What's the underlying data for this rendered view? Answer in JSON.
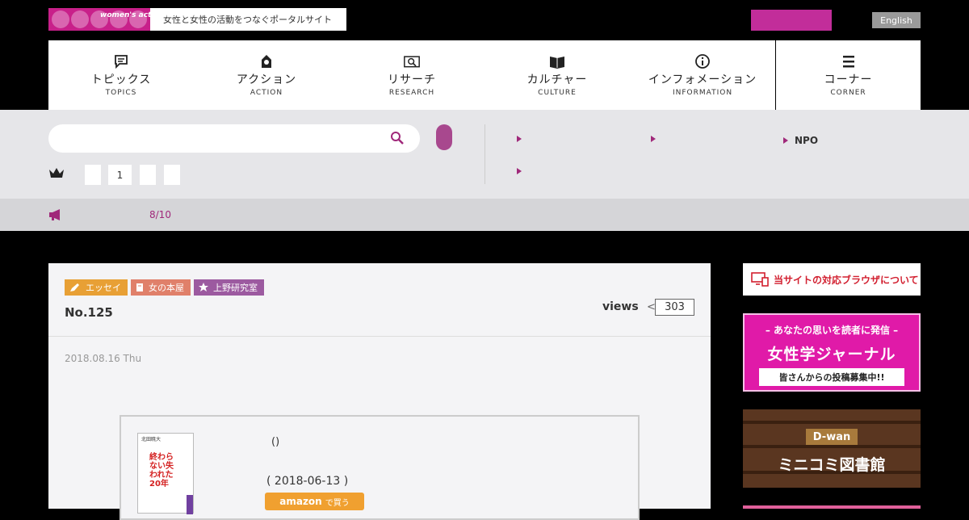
{
  "header": {
    "logo_brand": "women's action network",
    "logo_tagline": "女性と女性の活動をつなぐポータルサイト",
    "english_button": "English",
    "colors": {
      "accent": "#c22d9a",
      "brand_purple": "#a0287a"
    }
  },
  "nav": {
    "items": [
      {
        "label": "トピックス",
        "sub": "TOPICS",
        "icon": "speech-bubble-icon"
      },
      {
        "label": "アクション",
        "sub": "ACTION",
        "icon": "person-icon"
      },
      {
        "label": "リサーチ",
        "sub": "RESEARCH",
        "icon": "magnifier-icon"
      },
      {
        "label": "カルチャー",
        "sub": "CULTURE",
        "icon": "book-icon"
      },
      {
        "label": "インフォメーション",
        "sub": "INFORMATION",
        "icon": "info-icon"
      },
      {
        "label": "コーナー",
        "sub": "CORNER",
        "icon": "hamburger-icon"
      }
    ]
  },
  "search": {
    "placeholder": "",
    "pagination": [
      "",
      "1",
      "",
      ""
    ],
    "categories": [
      "",
      "",
      "NPO",
      ""
    ]
  },
  "news": {
    "date": "8/10"
  },
  "article": {
    "tags": [
      {
        "label": "エッセイ",
        "color": "#e8a035",
        "icon": "pen-icon"
      },
      {
        "label": "女の本屋",
        "color": "#e0806a",
        "icon": "book-icon"
      },
      {
        "label": "上野研究室",
        "color": "#9c5aa0",
        "icon": "star-icon"
      }
    ],
    "number": "No.125",
    "views_label": "views",
    "views_count": "303",
    "date": "2018.08.16 Thu",
    "book": {
      "author": "北田暁大",
      "title": "終わらない失われた20年",
      "paren": "()",
      "published": "( 2018-06-13 )",
      "amazon_logo": "amazon",
      "amazon_buy": "で買う"
    }
  },
  "sidebar": {
    "browser_notice": "当サイトの対応ブラウザについて",
    "journal_top": "– あなたの思いを読者に発信 –",
    "journal_main": "女性学ジャーナル",
    "journal_ribbon": "皆さんからの投稿募集中!!",
    "dwan_badge": "D-wan",
    "dwan_title": "ミニコミ図書館"
  }
}
